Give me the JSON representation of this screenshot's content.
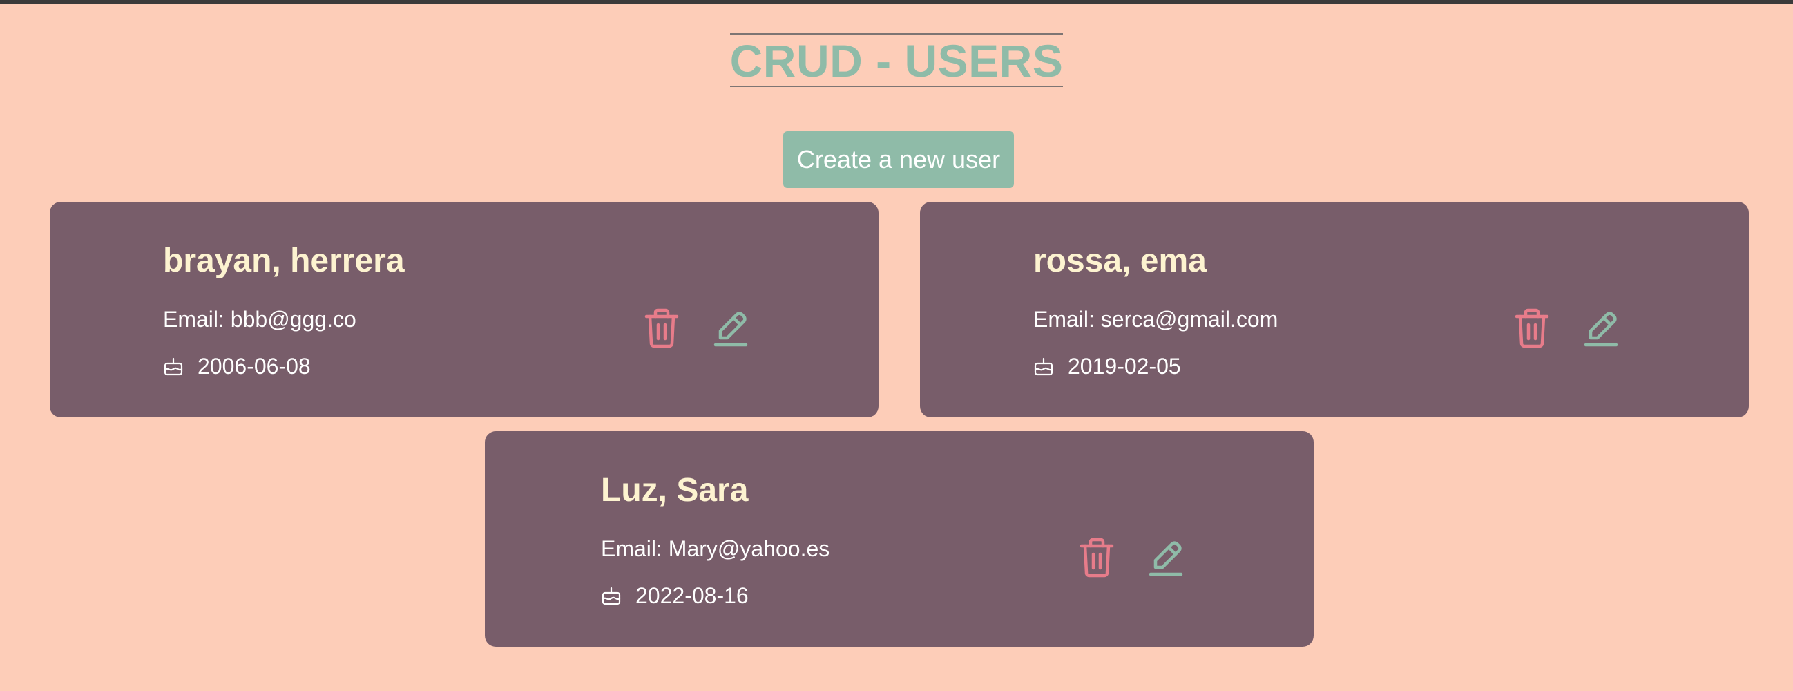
{
  "page": {
    "title": "CRUD - USERS",
    "create_button_label": "Create a new user"
  },
  "colors": {
    "background": "#fdcdb8",
    "accent": "#8fbba8",
    "card": "#785d6a",
    "delete": "#e77c8a",
    "name_text": "#fdf3d0"
  },
  "icons": {
    "delete": "trash-icon",
    "edit": "pencil-icon",
    "birthday": "cake-icon"
  },
  "users": [
    {
      "name": "brayan, herrera",
      "email": "Email: bbb@ggg.co",
      "birthday": "2006-06-08"
    },
    {
      "name": "rossa, ema",
      "email": "Email: serca@gmail.com",
      "birthday": "2019-02-05"
    },
    {
      "name": "Luz, Sara",
      "email": "Email: Mary@yahoo.es",
      "birthday": "2022-08-16"
    }
  ]
}
